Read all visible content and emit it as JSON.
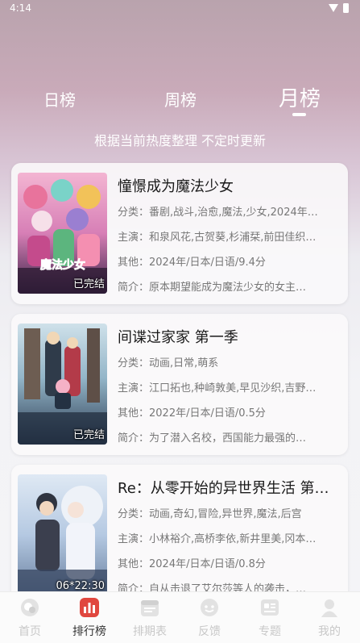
{
  "status_bar": {
    "time": "4:14"
  },
  "tabs": [
    {
      "label": "日榜"
    },
    {
      "label": "周榜"
    },
    {
      "label": "月榜",
      "active": true
    }
  ],
  "subtitle": "根据当前热度整理 不定时更新",
  "cards": [
    {
      "title": "憧憬成为魔法少女",
      "badge": "已完结",
      "logo_text": "魔法少女",
      "category": "分类：番剧,战斗,治愈,魔法,少女,2024年…",
      "cast": "主演：和泉风花,古贺葵,杉浦栞,前田佳织…",
      "other": "其他：2024年/日本/日语/9.4分",
      "summary": "简介：原本期望能成为魔法少女的女主…"
    },
    {
      "title": "间谍过家家 第一季",
      "badge": "已完结",
      "category": "分类：动画,日常,萌系",
      "cast": "主演：江口拓也,种崎敦美,早见沙织,吉野…",
      "other": "其他：2022年/日本/日语/0.5分",
      "summary": "简介：为了潜入名校，西国能力最强的…"
    },
    {
      "title": "Re：从零开始的异世界生活 第…",
      "badge": "06*22:30",
      "category": "分类：动画,奇幻,冒险,异世界,魔法,后宫",
      "cast": "主演：小林裕介,高桥李依,新井里美,冈本…",
      "other": "其他：2024年/日本/日语/0.8分",
      "summary": "简介：自从击退了艾尔莎等人的袭击，…"
    }
  ],
  "bottom_nav": [
    {
      "label": "首页",
      "icon": "home-icon"
    },
    {
      "label": "排行榜",
      "icon": "ranking-icon",
      "active": true
    },
    {
      "label": "排期表",
      "icon": "calendar-icon"
    },
    {
      "label": "反馈",
      "icon": "feedback-icon"
    },
    {
      "label": "专题",
      "icon": "topic-icon"
    },
    {
      "label": "我的",
      "icon": "profile-icon"
    }
  ],
  "colors": {
    "accent": "#e0473f",
    "nav_inactive": "#c8c8c8",
    "nav_active": "#333333"
  }
}
